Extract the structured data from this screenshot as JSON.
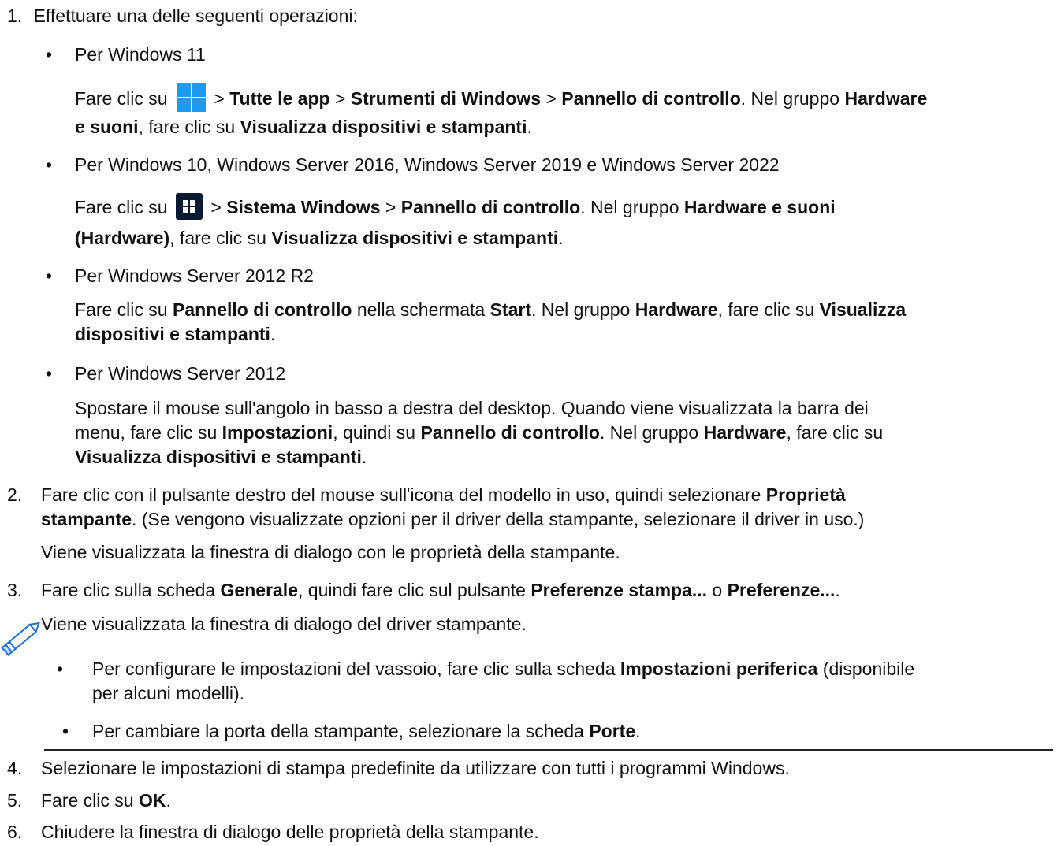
{
  "steps": [
    {
      "num": "1.",
      "text": "Effettuare una delle seguenti operazioni:"
    },
    {
      "num": "2.",
      "line1_pre": "Fare clic con il pulsante destro del mouse sull'icona del modello in uso, quindi selezionare ",
      "line1_bold": "Proprietà",
      "line2_bold": "stampante",
      "line2_post": ". (Se vengono visualizzate opzioni per il driver della stampante, selezionare il driver in uso.)",
      "result": "Viene visualizzata la finestra di dialogo con le proprietà della stampante."
    },
    {
      "num": "3.",
      "pre": "Fare clic sulla scheda ",
      "b1": "Generale",
      "mid1": ", quindi fare clic sul pulsante ",
      "b2": "Preferenze stampa...",
      "mid2": " o ",
      "b3": "Preferenze...",
      "post": ".",
      "result": "Viene visualizzata la finestra di dialogo del driver stampante."
    },
    {
      "num": "4.",
      "text": "Selezionare le impostazioni di stampa predefinite da utilizzare con tutti i programmi Windows."
    },
    {
      "num": "5.",
      "pre": "Fare clic su ",
      "bold": "OK",
      "post": "."
    },
    {
      "num": "6.",
      "text": "Chiudere la finestra di dialogo delle proprietà della stampante."
    }
  ],
  "bullet_char": "•",
  "win11": {
    "label": "Per Windows 11",
    "l1_pre": "Fare clic su ",
    "sep": " > ",
    "b1": "Tutte le app",
    "b2": "Strumenti di Windows",
    "b3": "Pannello di controllo",
    "l1_mid": ". Nel gruppo ",
    "b4": "Hardware",
    "l2_b": "e suoni",
    "l2_mid": ", fare clic su ",
    "l2_b2": "Visualizza dispositivi e stampanti",
    "l2_post": "."
  },
  "win10": {
    "label": "Per Windows 10, Windows Server 2016, Windows Server 2019 e Windows Server 2022",
    "l1_pre": "Fare clic su ",
    "sep": " > ",
    "b1": "Sistema Windows",
    "b2": "Pannello di controllo",
    "l1_mid": ". Nel gruppo ",
    "b3": "Hardware e suoni",
    "l2_b": "(Hardware)",
    "l2_mid": ", fare clic su ",
    "l2_b2": "Visualizza dispositivi e stampanti",
    "l2_post": "."
  },
  "ws2012r2": {
    "label": "Per Windows Server 2012 R2",
    "l1_pre": "Fare clic su ",
    "b1": "Pannello di controllo",
    "l1_mid1": " nella schermata ",
    "b2": "Start",
    "l1_mid2": ". Nel gruppo ",
    "b3": "Hardware",
    "l1_mid3": ", fare clic su ",
    "b4": "Visualizza",
    "l2_b": "dispositivi e stampanti",
    "l2_post": "."
  },
  "ws2012": {
    "label": "Per Windows Server 2012",
    "l1": "Spostare il mouse sull'angolo in basso a destra del desktop. Quando viene visualizzata la barra dei",
    "l2_pre": "menu, fare clic su ",
    "b1": "Impostazioni",
    "l2_mid1": ", quindi su ",
    "b2": "Pannello di controllo",
    "l2_mid2": ". Nel gruppo ",
    "b3": "Hardware",
    "l2_mid3": ", fare clic su",
    "l3_b": "Visualizza dispositivi e stampanti",
    "l3_post": "."
  },
  "note": {
    "n1_pre": "Per configurare le impostazioni del vassoio, fare clic sulla scheda ",
    "n1_b": "Impostazioni periferica",
    "n1_post": " (disponibile",
    "n1_l2": "per alcuni modelli).",
    "n2_pre": "Per cambiare la porta della stampante, selezionare la scheda ",
    "n2_b": "Porte",
    "n2_post": "."
  },
  "icons": {
    "win11": "windows-11-logo-icon",
    "win10": "windows-10-logo-icon",
    "note": "pencil-note-icon"
  },
  "colors": {
    "win11_blue": "#1E9BF0",
    "win10_bg": "#0b1a33",
    "text": "#111111"
  }
}
